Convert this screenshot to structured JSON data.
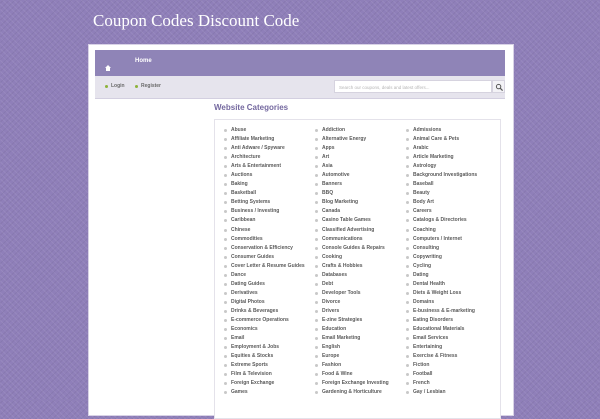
{
  "site": {
    "title": "Coupon Codes Discount Code"
  },
  "nav": {
    "home_label": "Home"
  },
  "subbar": {
    "login_label": "Login",
    "register_label": "Register",
    "search_placeholder": "Search our coupons, deals and latest offers..."
  },
  "content": {
    "section_title": "Website Categories"
  },
  "categories": {
    "col1": [
      "Abuse",
      "Affiliate Marketing",
      "Anti Adware / Spyware",
      "Architecture",
      "Arts & Entertainment",
      "Auctions",
      "Baking",
      "Basketball",
      "Betting Systems",
      "Business / Investing",
      "Caribbean",
      "Chinese",
      "Commodities",
      "Conservation & Efficiency",
      "Consumer Guides",
      "Cover Letter & Resume Guides",
      "Dance",
      "Dating Guides",
      "Derivatives",
      "Digital Photos",
      "Drinks & Beverages",
      "E-commerce Operations",
      "Economics",
      "Email",
      "Employment & Jobs",
      "Equities & Stocks",
      "Extreme Sports",
      "Film & Television",
      "Foreign Exchange",
      "Games"
    ],
    "col2": [
      "Addiction",
      "Alternative Energy",
      "Apps",
      "Art",
      "Asia",
      "Automotive",
      "Banners",
      "BBQ",
      "Blog Marketing",
      "Canada",
      "Casino Table Games",
      "Classified Advertising",
      "Communications",
      "Console Guides & Repairs",
      "Cooking",
      "Crafts & Hobbies",
      "Databases",
      "Debt",
      "Developer Tools",
      "Divorce",
      "Drivers",
      "E-zine Strategies",
      "Education",
      "Email Marketing",
      "English",
      "Europe",
      "Fashion",
      "Food & Wine",
      "Foreign Exchange Investing",
      "Gardening & Horticulture"
    ],
    "col3": [
      "Admissions",
      "Animal Care & Pets",
      "Arabic",
      "Article Marketing",
      "Astrology",
      "Background Investigations",
      "Baseball",
      "Beauty",
      "Body Art",
      "Careers",
      "Catalogs & Directories",
      "Coaching",
      "Computers / Internet",
      "Consulting",
      "Copywriting",
      "Cycling",
      "Dating",
      "Dental Health",
      "Diets & Weight Loss",
      "Domains",
      "E-business & E-marketing",
      "Eating Disorders",
      "Educational Materials",
      "Email Services",
      "Entertaining",
      "Exercise & Fitness",
      "Fiction",
      "Football",
      "French",
      "Gay / Lesbian"
    ]
  },
  "colors": {
    "background": "#8f7fb9",
    "navbar": "#8f84b7",
    "title_accent": "#74689f",
    "bullet_green": "#8db33a"
  }
}
